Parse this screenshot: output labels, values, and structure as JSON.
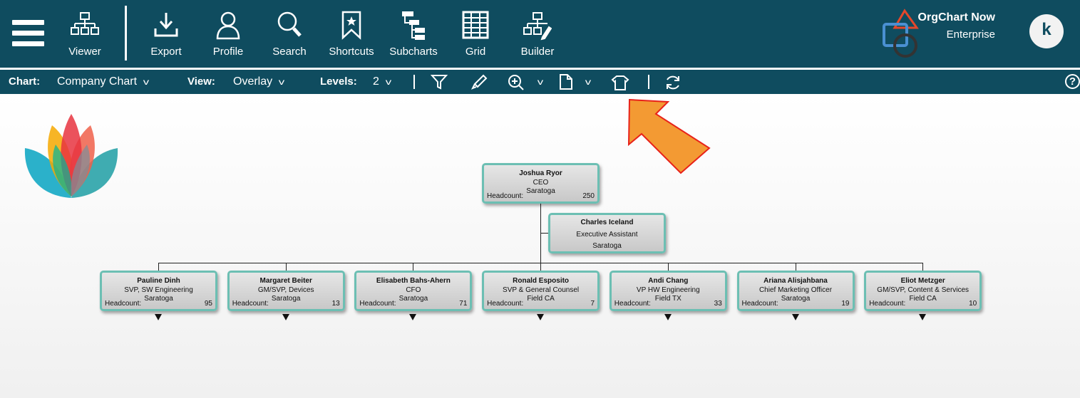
{
  "header": {
    "tools": [
      "Viewer",
      "Export",
      "Profile",
      "Search",
      "Shortcuts",
      "Subcharts",
      "Grid",
      "Builder"
    ],
    "brand": "OrgChart Now",
    "edition": "Enterprise",
    "avatar": "k"
  },
  "toolbar": {
    "chart_label": "Chart:",
    "chart_value": "Company Chart",
    "view_label": "View:",
    "view_value": "Overlay",
    "levels_label": "Levels:",
    "levels_value": "2",
    "help": "?"
  },
  "colors": {
    "header": "#0f4c5f",
    "node_border": "#6cbfb3",
    "arrow": "#f39a33"
  },
  "ceo": {
    "name": "Joshua Ryor",
    "title": "CEO",
    "location": "Saratoga",
    "headcount_label": "Headcount:",
    "headcount": "250"
  },
  "assistant": {
    "name": "Charles Iceland",
    "title": "Executive Assistant",
    "location": "Saratoga"
  },
  "reports": [
    {
      "name": "Pauline Dinh",
      "title": "SVP, SW Engineering",
      "location": "Saratoga",
      "headcount_label": "Headcount:",
      "headcount": "95"
    },
    {
      "name": "Margaret Beiter",
      "title": "GM/SVP, Devices",
      "location": "Saratoga",
      "headcount_label": "Headcount:",
      "headcount": "13"
    },
    {
      "name": "Elisabeth Bahs-Ahern",
      "title": "CFO",
      "location": "Saratoga",
      "headcount_label": "Headcount:",
      "headcount": "71"
    },
    {
      "name": "Ronald Esposito",
      "title": "SVP & General Counsel",
      "location": "Field CA",
      "headcount_label": "Headcount:",
      "headcount": "7"
    },
    {
      "name": "Andi Chang",
      "title": "VP HW Engineering",
      "location": "Field TX",
      "headcount_label": "Headcount:",
      "headcount": "33"
    },
    {
      "name": "Ariana Alisjahbana",
      "title": "Chief Marketing Officer",
      "location": "Saratoga",
      "headcount_label": "Headcount:",
      "headcount": "19"
    },
    {
      "name": "Eliot Metzger",
      "title": "GM/SVP, Content & Services",
      "location": "Field CA",
      "headcount_label": "Headcount:",
      "headcount": "10"
    }
  ]
}
